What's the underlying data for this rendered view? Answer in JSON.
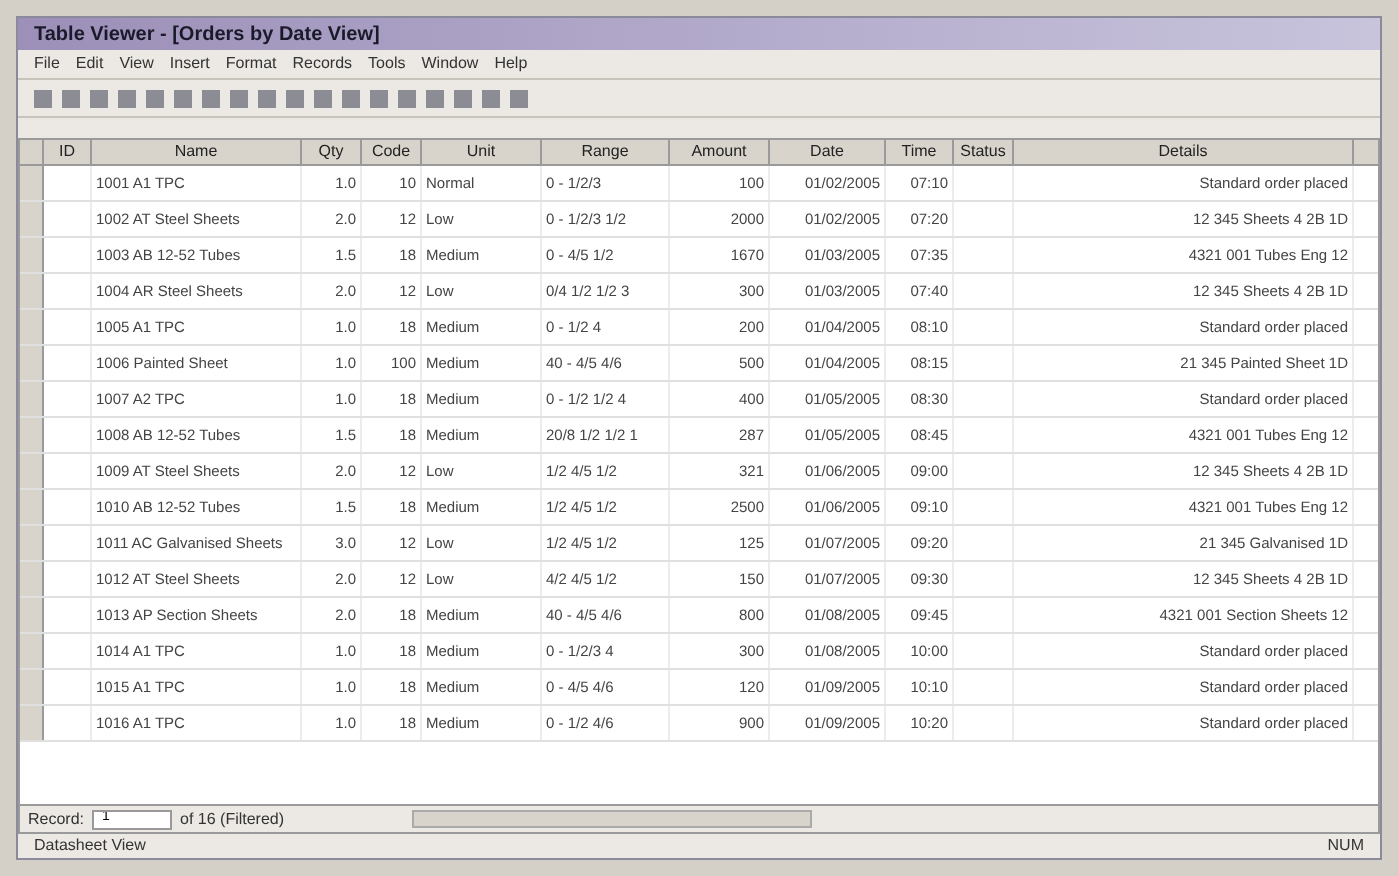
{
  "window": {
    "title": "Table Viewer - [Orders by Date View]"
  },
  "menu": [
    "File",
    "Edit",
    "View",
    "Insert",
    "Format",
    "Records",
    "Tools",
    "Window",
    "Help"
  ],
  "table": {
    "columns": [
      "ID",
      "Name",
      "Qty",
      "Code",
      "Unit",
      "Range",
      "Amount",
      "Date",
      "Time",
      "Status",
      "Details"
    ],
    "rows": [
      {
        "selected": false,
        "cells": [
          "",
          "1001 A1 TPC",
          "1.0",
          "10",
          "Normal",
          "0 - 1/2/3",
          "100",
          "01/02/2005",
          "07:10",
          "",
          "Standard order placed"
        ]
      },
      {
        "selected": false,
        "cells": [
          "",
          "1002 AT Steel Sheets",
          "2.0",
          "12",
          "Low",
          "0 - 1/2/3 1/2",
          "2000",
          "01/02/2005",
          "07:20",
          "",
          "12 345 Sheets 4 2B 1D"
        ]
      },
      {
        "selected": false,
        "cells": [
          "",
          "1003 AB 12-52 Tubes",
          "1.5",
          "18",
          "Medium",
          "0 - 4/5 1/2",
          "1670",
          "01/03/2005",
          "07:35",
          "",
          "4321 001 Tubes Eng 12"
        ]
      },
      {
        "selected": false,
        "cells": [
          "",
          "1004 AR Steel Sheets",
          "2.0",
          "12",
          "Low",
          "0/4 1/2 1/2 3",
          "300",
          "01/03/2005",
          "07:40",
          "",
          "12 345 Sheets 4 2B 1D"
        ]
      },
      {
        "selected": false,
        "cells": [
          "",
          "1005 A1 TPC",
          "1.0",
          "18",
          "Medium",
          "0 - 1/2 4",
          "200",
          "01/04/2005",
          "08:10",
          "",
          "Standard order placed"
        ]
      },
      {
        "selected": false,
        "cells": [
          "",
          "1006 Painted Sheet",
          "1.0",
          "100",
          "Medium",
          "40 - 4/5 4/6",
          "500",
          "01/04/2005",
          "08:15",
          "",
          "21 345 Painted Sheet 1D"
        ]
      },
      {
        "selected": false,
        "cells": [
          "",
          "1007 A2 TPC",
          "1.0",
          "18",
          "Medium",
          "0 - 1/2 1/2 4",
          "400",
          "01/05/2005",
          "08:30",
          "",
          "Standard order placed"
        ]
      },
      {
        "selected": false,
        "cells": [
          "",
          "1008 AB 12-52 Tubes",
          "1.5",
          "18",
          "Medium",
          "20/8 1/2 1/2 1",
          "287",
          "01/05/2005",
          "08:45",
          "",
          "4321 001 Tubes Eng 12"
        ]
      },
      {
        "selected": false,
        "cells": [
          "",
          "1009 AT Steel Sheets",
          "2.0",
          "12",
          "Low",
          "1/2 4/5 1/2",
          "321",
          "01/06/2005",
          "09:00",
          "",
          "12 345 Sheets 4 2B 1D"
        ]
      },
      {
        "selected": false,
        "cells": [
          "",
          "1010 AB 12-52 Tubes",
          "1.5",
          "18",
          "Medium",
          "1/2 4/5 1/2",
          "2500",
          "01/06/2005",
          "09:10",
          "",
          "4321 001 Tubes Eng 12"
        ]
      },
      {
        "selected": false,
        "cells": [
          "",
          "1011 AC Galvanised Sheets",
          "3.0",
          "12",
          "Low",
          "1/2 4/5 1/2",
          "125",
          "01/07/2005",
          "09:20",
          "",
          "21 345 Galvanised 1D"
        ]
      },
      {
        "selected": false,
        "cells": [
          "",
          "1012 AT Steel Sheets",
          "2.0",
          "12",
          "Low",
          "4/2 4/5 1/2",
          "150",
          "01/07/2005",
          "09:30",
          "",
          "12 345 Sheets 4 2B 1D"
        ]
      },
      {
        "selected": false,
        "cells": [
          "",
          "1013 AP Section Sheets",
          "2.0",
          "18",
          "Medium",
          "40 - 4/5 4/6",
          "800",
          "01/08/2005",
          "09:45",
          "",
          "4321 001 Section Sheets 12"
        ]
      },
      {
        "selected": false,
        "cells": [
          "",
          "1014 A1 TPC",
          "1.0",
          "18",
          "Medium",
          "0 - 1/2/3 4",
          "300",
          "01/08/2005",
          "10:00",
          "",
          "Standard order placed"
        ]
      },
      {
        "selected": false,
        "cells": [
          "",
          "1015 A1 TPC",
          "1.0",
          "18",
          "Medium",
          "0 - 4/5 4/6",
          "120",
          "01/09/2005",
          "10:10",
          "",
          "Standard order placed"
        ]
      },
      {
        "selected": false,
        "cells": [
          "",
          "1016 A1 TPC",
          "1.0",
          "18",
          "Medium",
          "0 - 1/2 4/6",
          "900",
          "01/09/2005",
          "10:20",
          "",
          "Standard order placed"
        ]
      }
    ]
  },
  "navigator": {
    "label": "Record:",
    "value": "1",
    "total": "of 16 (Filtered)"
  },
  "status_bar": {
    "left": "Datasheet View",
    "right": "NUM"
  }
}
